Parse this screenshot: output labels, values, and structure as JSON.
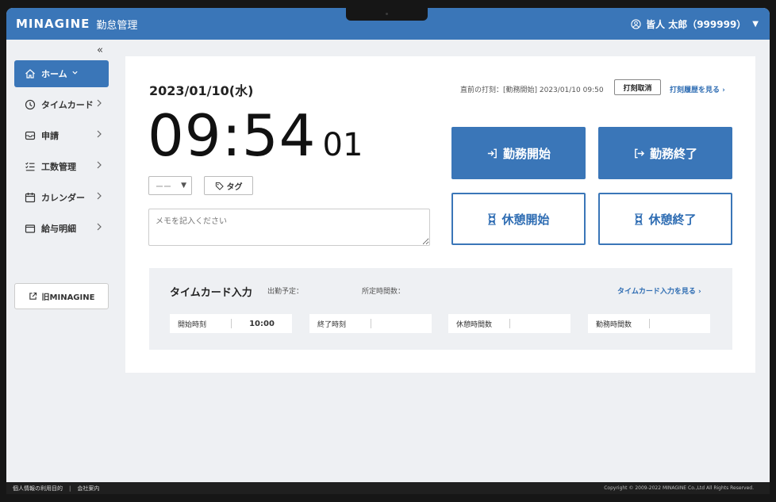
{
  "header": {
    "brand": "MINAGINE",
    "product": "勤怠管理",
    "user": "皆人 太郎（999999）"
  },
  "sidebar": {
    "collapse_glyph": "«",
    "items": [
      {
        "label": "ホーム",
        "icon": "home-icon",
        "active": true
      },
      {
        "label": "タイムカード",
        "icon": "clock-icon"
      },
      {
        "label": "申請",
        "icon": "inbox-icon"
      },
      {
        "label": "工数管理",
        "icon": "checklist-icon"
      },
      {
        "label": "カレンダー",
        "icon": "calendar-icon"
      },
      {
        "label": "給与明細",
        "icon": "wallet-icon"
      }
    ],
    "old_link": "旧MINAGINE"
  },
  "main": {
    "date": "2023/01/10(水)",
    "time_hm": "09:54",
    "time_sec": "01",
    "last_punch": "直前の打刻：[勤務開始] 2023/01/10 09:50",
    "cancel_label": "打刻取消",
    "history_label": "打刻履歴を見る",
    "select_value": "ーー",
    "tag_label": "タグ",
    "memo_placeholder": "メモを記入ください",
    "buttons": {
      "start_work": "勤務開始",
      "end_work": "勤務終了",
      "start_break": "休憩開始",
      "end_break": "休憩終了"
    }
  },
  "timecard": {
    "title": "タイムカード入力",
    "scheduled_label": "出勤予定：",
    "hours_label": "所定時間数：",
    "link_label": "タイムカード入力を見る",
    "fields": [
      {
        "label": "開始時刻",
        "value": "10:00"
      },
      {
        "label": "終了時刻",
        "value": ""
      },
      {
        "label": "休憩時間数",
        "value": ""
      },
      {
        "label": "勤務時間数",
        "value": ""
      }
    ]
  },
  "footer": {
    "privacy": "個人情報の利用目的",
    "company": "会社案内",
    "copyright": "Copyright © 2009-2022 MINAGINE Co.,Ltd All Rights Reserved."
  },
  "colors": {
    "primary": "#3a76b8",
    "link": "#2f6db3",
    "background": "#eef0f3"
  }
}
